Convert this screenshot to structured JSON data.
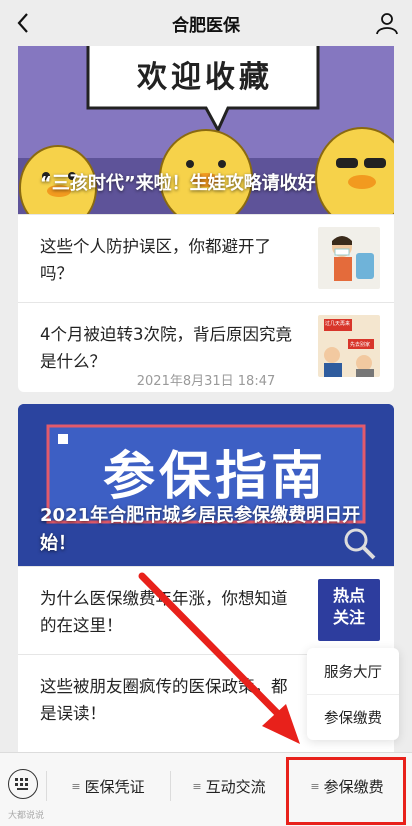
{
  "header": {
    "title": "合肥医保"
  },
  "card1": {
    "banner_sign": "欢迎收藏",
    "banner_caption": "“三孩时代”来啦！生娃攻略请收好",
    "items": [
      {
        "text": "这些个人防护误区，你都避开了吗？"
      },
      {
        "text": "4个月被迫转3次院，背后原因究竟是什么？",
        "thumb_labels": [
          "过几天再来",
          "先去别家"
        ]
      }
    ]
  },
  "timestamp": "2021年8月31日 18:47",
  "card2": {
    "banner_title": "参保指南",
    "banner_caption": "2021年合肥市城乡居民参保缴费明日开始！",
    "items": [
      {
        "text": "为什么医保缴费年年涨，你想知道的在这里！",
        "thumb_labels": [
          "热点",
          "关注"
        ]
      },
      {
        "text": "这些被朋友圈疯传的医保政策，都是误读！"
      }
    ]
  },
  "popup_menu": {
    "items": [
      "服务大厅",
      "参保缴费"
    ]
  },
  "bottom_menu": {
    "tabs": [
      "医保凭证",
      "互动交流",
      "参保缴费"
    ],
    "tab_prefix": "≡"
  },
  "watermark": "大都说说",
  "colors": {
    "accent_red": "#e8211b",
    "banner1_bg": "#7a6fb6",
    "banner2_bg": "#2f4aa8"
  },
  "icons": [
    "back-arrow-icon",
    "profile-icon",
    "keyboard-icon",
    "search-magnifier-icon"
  ]
}
